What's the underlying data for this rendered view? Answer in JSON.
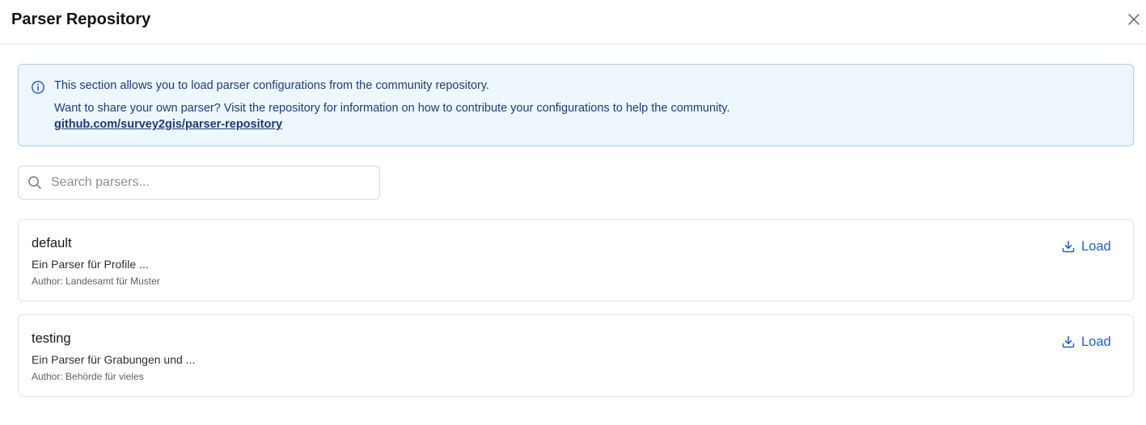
{
  "modal": {
    "title": "Parser Repository",
    "close_icon": "close-icon"
  },
  "info": {
    "icon": "info-icon",
    "line1": "This section allows you to load parser configurations from the community repository.",
    "line2": "Want to share your own parser? Visit the repository for information on how to contribute your configurations to help the community.",
    "link_text": "github.com/survey2gis/parser-repository"
  },
  "search": {
    "icon": "search-icon",
    "placeholder": "Search parsers...",
    "value": ""
  },
  "parsers": [
    {
      "name": "default",
      "description": "Ein Parser für Profile ...",
      "author": "Author: Landesamt für Muster",
      "load_label": "Load",
      "load_icon": "download-icon"
    },
    {
      "name": "testing",
      "description": "Ein Parser für Grabungen und ...",
      "author": "Author: Behörde für vieles",
      "load_label": "Load",
      "load_icon": "download-icon"
    }
  ],
  "colors": {
    "accent": "#1d63c9",
    "info_bg": "#eef6fe",
    "info_border": "#a9d0f4",
    "info_text": "#1c3f7a"
  }
}
